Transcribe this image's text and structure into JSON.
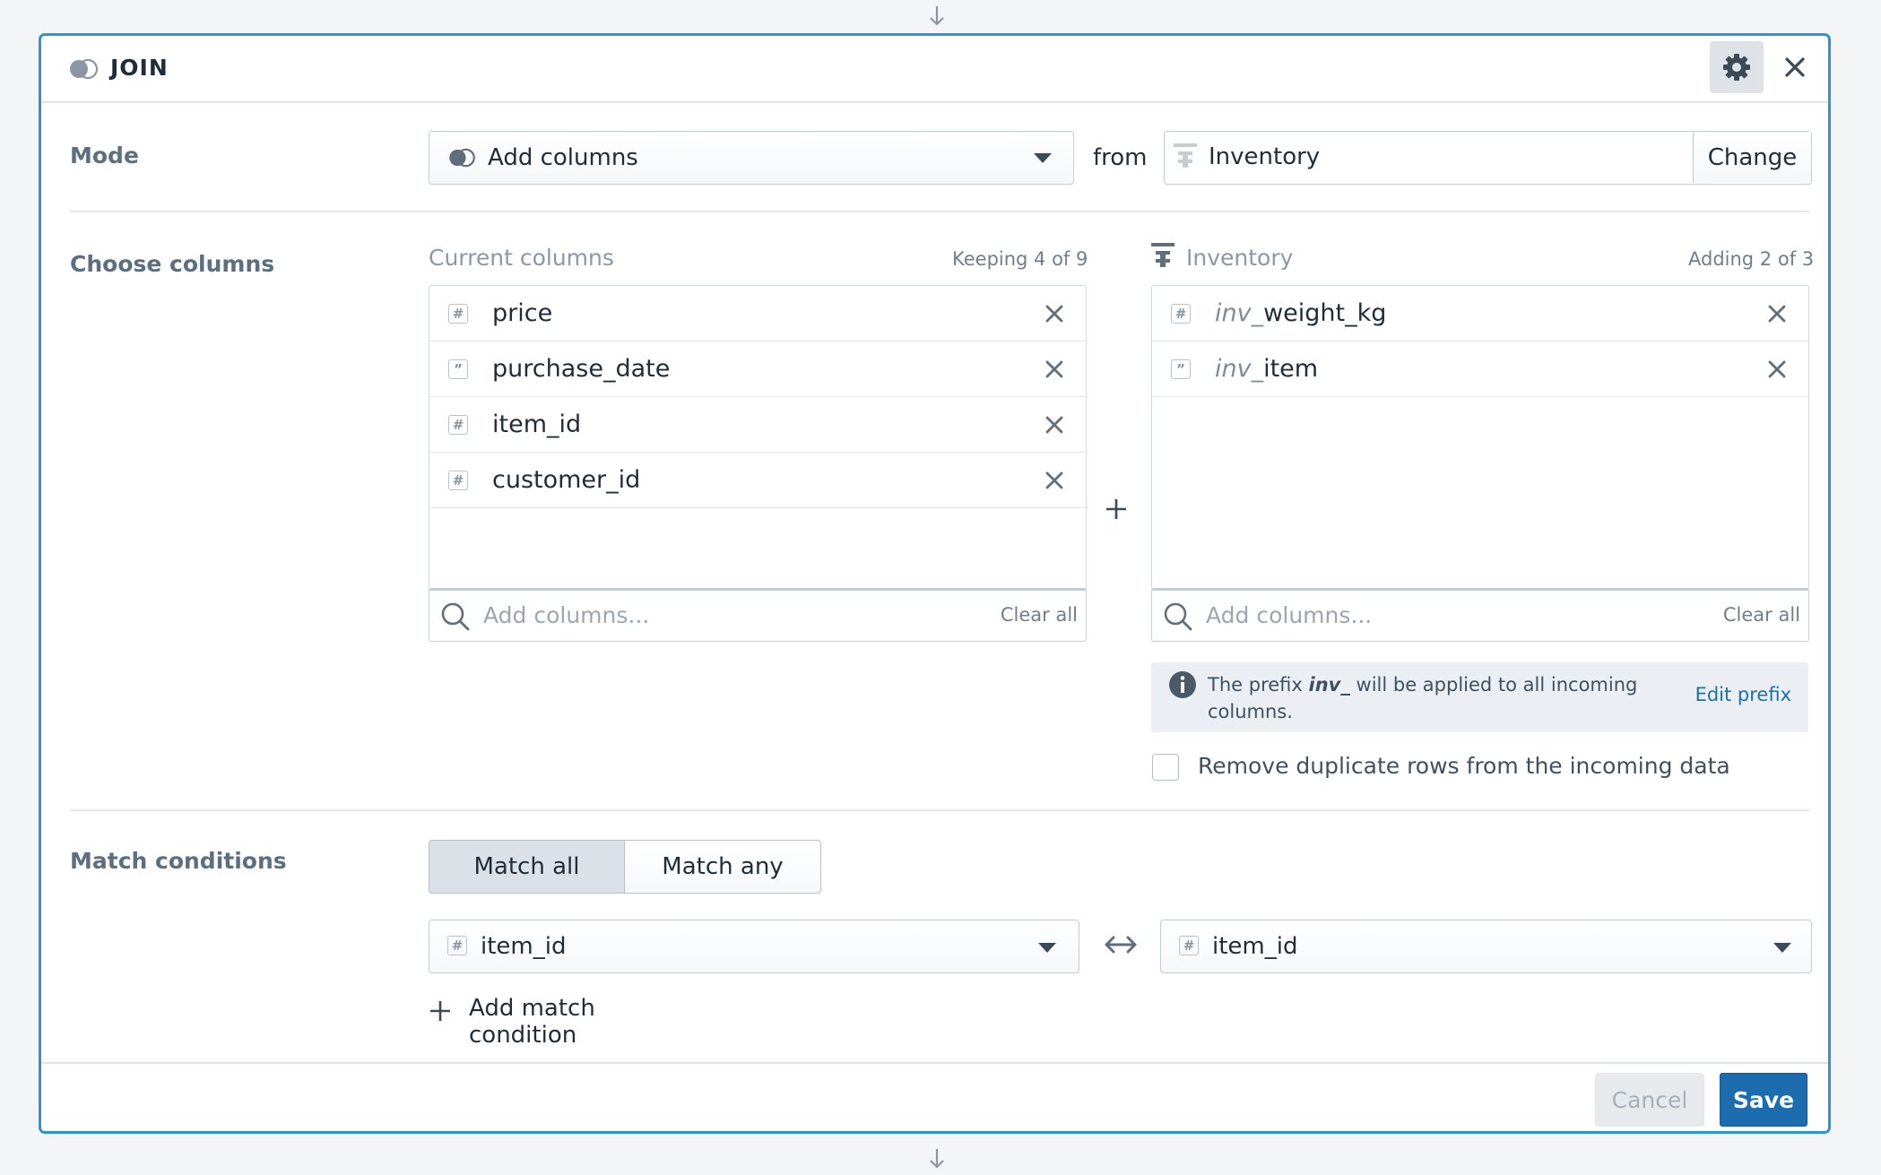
{
  "node": {
    "title": "JOIN"
  },
  "mode": {
    "label": "Mode",
    "selected": "Add columns",
    "from_label": "from",
    "source": "Inventory",
    "change_label": "Change"
  },
  "choose_columns": {
    "label": "Choose columns",
    "current": {
      "header": "Current columns",
      "count": "Keeping 4 of 9",
      "columns": [
        {
          "name": "price",
          "type_icon": "number-icon"
        },
        {
          "name": "purchase_date",
          "type_icon": "string-icon"
        },
        {
          "name": "item_id",
          "type_icon": "number-icon"
        },
        {
          "name": "customer_id",
          "type_icon": "number-icon"
        }
      ],
      "search_placeholder": "Add columns...",
      "clear_label": "Clear all"
    },
    "incoming": {
      "header": "Inventory",
      "count": "Adding 2 of 3",
      "columns": [
        {
          "prefix": "inv_",
          "name": "weight_kg",
          "type_icon": "number-icon"
        },
        {
          "prefix": "inv_",
          "name": "item",
          "type_icon": "string-icon"
        }
      ],
      "search_placeholder": "Add columns...",
      "clear_label": "Clear all"
    },
    "prefix_info": {
      "text_before": "The prefix ",
      "prefix": "inv_",
      "text_after": " will be applied to all incoming columns.",
      "edit_label": "Edit prefix"
    },
    "dedupe_label": "Remove duplicate rows from the incoming data",
    "dedupe_checked": false
  },
  "match": {
    "label": "Match conditions",
    "modes": [
      "Match all",
      "Match any"
    ],
    "active_mode": "Match all",
    "left": "item_id",
    "right": "item_id",
    "add_label": "Add match condition"
  },
  "footer": {
    "cancel": "Cancel",
    "save": "Save"
  },
  "colors": {
    "accent": "#2b95d6",
    "primary": "#1c6cb0",
    "link": "#1a6fae"
  }
}
